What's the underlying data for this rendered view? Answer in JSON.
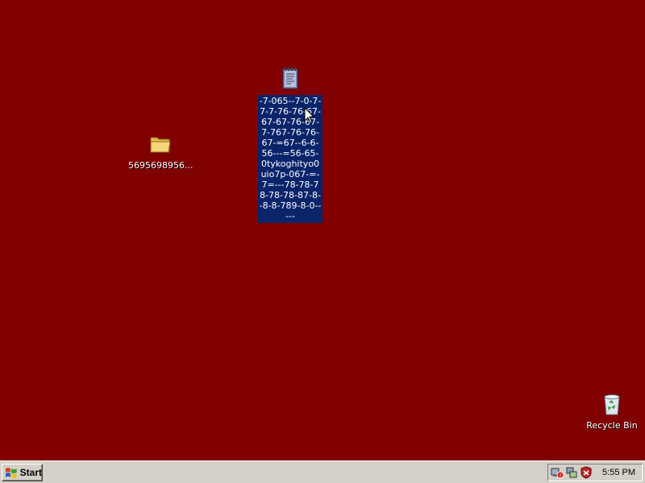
{
  "desktop": {
    "background_color": "#800000",
    "icons": [
      {
        "name": "text document",
        "icon": "notepad-doc-icon",
        "label": "-7-065--7-0-7-7-7-76-76-67-67-67-76-67-7-767-76-76-67-=67--6-6-56---=56-65-0tykoghityo0uio7p-067-=-7=---78-78-78-78-78-87-8--8-8-789-8-0-----",
        "selected": true
      },
      {
        "name": "folder",
        "icon": "folder-icon",
        "label": "5695698956..."
      },
      {
        "name": "recycle bin",
        "icon": "recycle-bin-icon",
        "label": "Recycle Bin"
      }
    ]
  },
  "taskbar": {
    "start_label": "Start",
    "tray_icons": [
      "network-warning-icon",
      "network-icon",
      "security-shield-icon"
    ],
    "clock": "5:55 PM",
    "selection_color": "#0a246a"
  }
}
